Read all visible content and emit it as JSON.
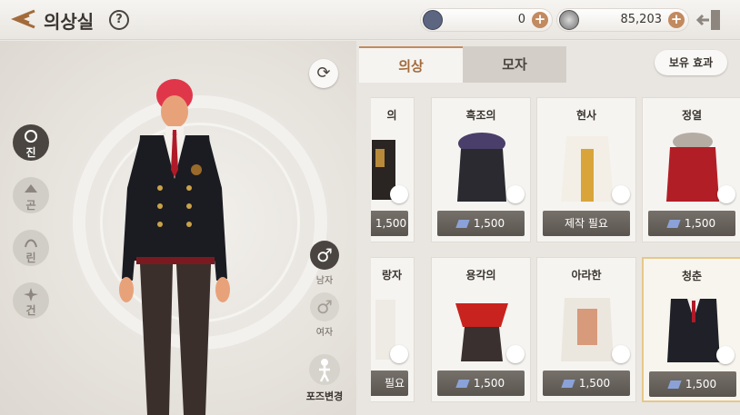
{
  "header": {
    "title": "의상실",
    "help": "?",
    "currency_gem": {
      "value": "0",
      "plus": "+"
    },
    "currency_coin": {
      "value": "85,203",
      "plus": "+"
    }
  },
  "side": {
    "races": [
      {
        "label": "진",
        "icon": "jin-race-icon",
        "active": true
      },
      {
        "label": "곤",
        "icon": "gon-race-icon",
        "active": false
      },
      {
        "label": "린",
        "icon": "lyn-race-icon",
        "active": false
      },
      {
        "label": "건",
        "icon": "gun-race-icon",
        "active": false
      }
    ],
    "male_symbol": "♂",
    "male_label": "남자",
    "female_symbol": "♂",
    "female_label": "여자",
    "pose_label": "포즈변경"
  },
  "tabs": {
    "costume": "의상",
    "hat": "모자"
  },
  "owned_effect_label": "보유 효과",
  "items": [
    {
      "name": "의",
      "price": "1,500",
      "has_gem": false
    },
    {
      "name": "흑조의",
      "price": "1,500",
      "has_gem": true
    },
    {
      "name": "현사",
      "price": "제작 필요",
      "has_gem": false
    },
    {
      "name": "정열",
      "price": "1,500",
      "has_gem": true
    },
    {
      "name": "랑자",
      "price": "필요",
      "has_gem": false
    },
    {
      "name": "용각의",
      "price": "1,500",
      "has_gem": true
    },
    {
      "name": "아라한",
      "price": "1,500",
      "has_gem": true
    },
    {
      "name": "청춘",
      "price": "1,500",
      "has_gem": true
    }
  ],
  "colors": {
    "accent": "#c28a5f",
    "price_button": "#5a554f",
    "selected_border": "#e6c88a"
  }
}
